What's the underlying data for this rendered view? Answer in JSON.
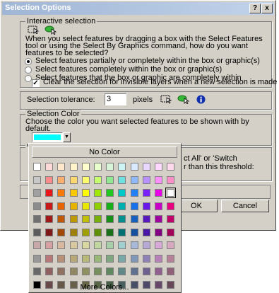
{
  "window": {
    "title": "Selection Options",
    "help_button": "?",
    "close_button": "x"
  },
  "interactive": {
    "group_title": "Interactive selection",
    "description": [
      "When you select features by dragging a box with the Select Features",
      "tool or using the Select By Graphics command, how do you want",
      "features to be selected?"
    ],
    "options": [
      {
        "label": "Select features partially or completely within the box or graphic(s)",
        "selected": true
      },
      {
        "label": "Select features completely within the box or graphic(s)",
        "selected": false
      },
      {
        "label": "Select features that the box or graphic are completely within",
        "selected": false
      }
    ],
    "clear_checkbox": {
      "label": "Clear the selection for invisible layers when a new selection is made",
      "checked": true
    }
  },
  "tolerance": {
    "label": "Selection tolerance:",
    "value": "3",
    "unit": "pixels"
  },
  "selection_color": {
    "group_title": "Selection Color",
    "description": [
      "Choose the color you want selected features to be shown with by",
      "default."
    ],
    "current_color": "#00ffff"
  },
  "hidden_group": {
    "title_fragment": "V",
    "text_lines": [
      "ct All' or 'Switch",
      "r than this threshold:"
    ]
  },
  "buttons": {
    "ok": "OK",
    "cancel": "Cancel"
  },
  "color_popup": {
    "no_color": "No Color",
    "more_colors": "More Colors...",
    "rows": [
      [
        "#ffffff",
        "#ffd8d8",
        "#ffe8cc",
        "#fff4cc",
        "#ffffcc",
        "#e8ffcc",
        "#d8f4d8",
        "#ccf4f4",
        "#d8e8ff",
        "#e8d8ff",
        "#ffd8ff",
        "#ffd8ec"
      ],
      [
        "#c8c8c8",
        "#ff8c8c",
        "#ffb070",
        "#ffd870",
        "#ffff70",
        "#c8ff70",
        "#90e890",
        "#70e0e0",
        "#90b8ff",
        "#b890ff",
        "#ff90ff",
        "#ff90c8"
      ],
      [
        "#a0a0a0",
        "#e81818",
        "#ff7800",
        "#ffc800",
        "#ffff00",
        "#a0e800",
        "#20c820",
        "#00c8c8",
        "#2080ff",
        "#7820ff",
        "#e800e8",
        "#ffffff"
      ],
      [
        "#8c8c8c",
        "#c81818",
        "#e86400",
        "#e8b400",
        "#e8e800",
        "#90d000",
        "#18b018",
        "#00b0b0",
        "#1870e8",
        "#6818e8",
        "#c800c8",
        "#e80080"
      ],
      [
        "#707070",
        "#a01818",
        "#c05800",
        "#c09800",
        "#c0c000",
        "#78b000",
        "#189018",
        "#009090",
        "#1860c0",
        "#5818c0",
        "#a000a0",
        "#c00068"
      ],
      [
        "#5c5c5c",
        "#801818",
        "#a04800",
        "#a08000",
        "#a0a000",
        "#609000",
        "#187018",
        "#007070",
        "#1850a0",
        "#4818a0",
        "#800080",
        "#a00058"
      ],
      [
        "#c8a8a8",
        "#d8a0a0",
        "#d8b8a0",
        "#d8c8a0",
        "#d8d8a0",
        "#c0d8a0",
        "#a8d0a8",
        "#a0d0d0",
        "#a8b8d8",
        "#b8a8d8",
        "#d8a8d8",
        "#d8a8c0"
      ],
      [
        "#989898",
        "#b87878",
        "#b89078",
        "#b8a878",
        "#b8b878",
        "#98b878",
        "#80a880",
        "#78a8a8",
        "#8098b8",
        "#9080b8",
        "#b880b8",
        "#b88098"
      ],
      [
        "#686868",
        "#906060",
        "#907060",
        "#908860",
        "#909060",
        "#789060",
        "#608860",
        "#608888",
        "#607090",
        "#706090",
        "#906090",
        "#906078"
      ],
      [
        "#000000",
        "#684848",
        "#685848",
        "#686048",
        "#686848",
        "#586848",
        "#486048",
        "#486060",
        "#485068",
        "#504868",
        "#684868",
        "#684858"
      ]
    ]
  }
}
